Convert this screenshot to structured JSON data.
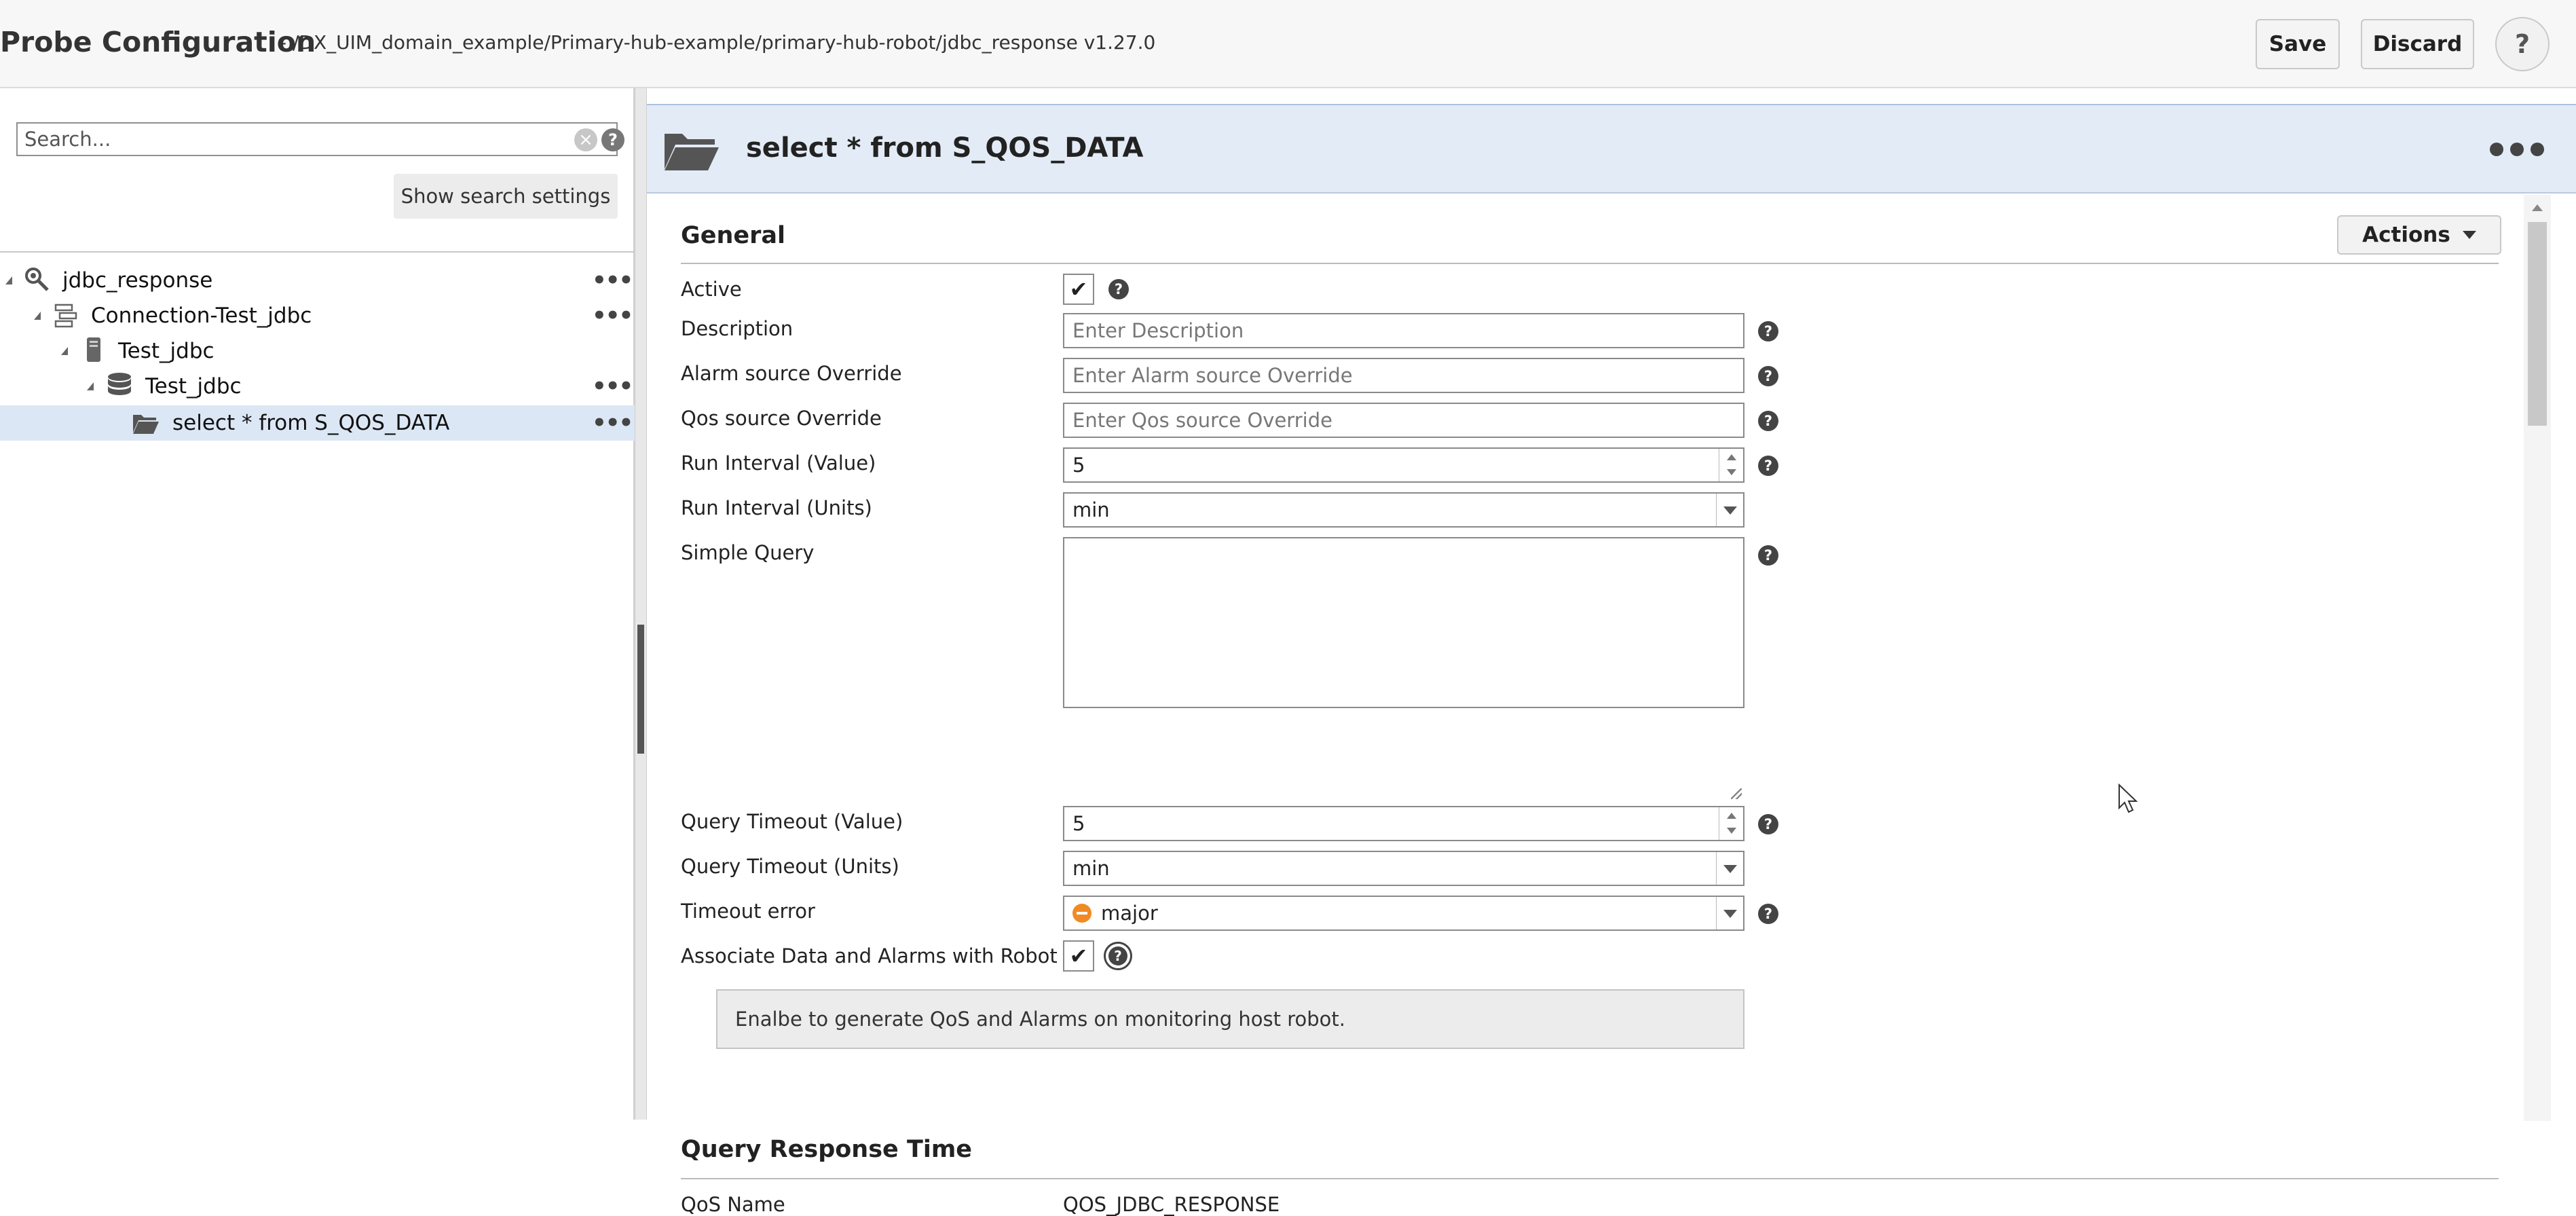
{
  "header": {
    "title": "Probe Configuration",
    "path": "- /DX_UIM_domain_example/Primary-hub-example/primary-hub-robot/jdbc_response v1.27.0",
    "save_label": "Save",
    "discard_label": "Discard",
    "help_label": "?"
  },
  "sidebar": {
    "search_placeholder": "Search...",
    "show_search_settings_label": "Show search settings",
    "tree": [
      {
        "label": "jdbc_response",
        "icon": "search-gear-icon"
      },
      {
        "label": "Connection-Test_jdbc",
        "icon": "connection-icon"
      },
      {
        "label": "Test_jdbc",
        "icon": "device-icon"
      },
      {
        "label": "Test_jdbc",
        "icon": "database-icon"
      },
      {
        "label": "select * from S_QOS_DATA",
        "icon": "folder-open-icon",
        "selected": true
      }
    ]
  },
  "panel": {
    "title": "select * from S_QOS_DATA",
    "actions_label": "Actions"
  },
  "general": {
    "section_title": "General",
    "active_label": "Active",
    "active_checked": true,
    "description_label": "Description",
    "description_placeholder": "Enter Description",
    "alarm_source_label": "Alarm source Override",
    "alarm_source_placeholder": "Enter Alarm source Override",
    "qos_source_label": "Qos source Override",
    "qos_source_placeholder": "Enter Qos source Override",
    "run_interval_value_label": "Run Interval (Value)",
    "run_interval_value": "5",
    "run_interval_units_label": "Run Interval (Units)",
    "run_interval_units": "min",
    "simple_query_label": "Simple Query",
    "query_timeout_value_label": "Query Timeout (Value)",
    "query_timeout_value": "5",
    "query_timeout_units_label": "Query Timeout (Units)",
    "query_timeout_units": "min",
    "timeout_error_label": "Timeout error",
    "timeout_error_value": "major",
    "timeout_error_color": "#f08a24",
    "associate_label": "Associate Data and Alarms with Robot",
    "associate_checked": true,
    "associate_info": "Enalbe to generate QoS and Alarms on monitoring host robot."
  },
  "query_response": {
    "section_title": "Query Response Time",
    "qos_name_label": "QoS Name",
    "qos_name_value": "QOS_JDBC_RESPONSE"
  },
  "colors": {
    "header_bg": "#e3ebf6",
    "selected_row_bg": "#dce7f5",
    "topbar_bg": "#f7f7f7"
  }
}
